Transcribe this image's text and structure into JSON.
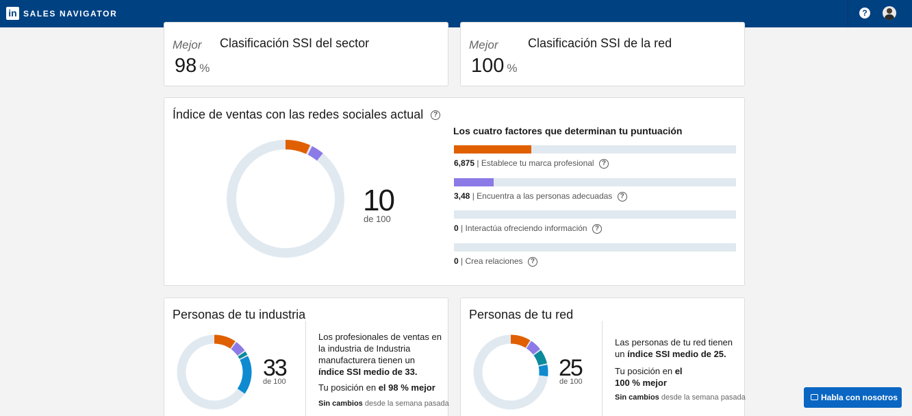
{
  "app": {
    "brand": "SALES NAVIGATOR",
    "logo": "in"
  },
  "industry_rank": {
    "best_label": "Mejor",
    "value": "98",
    "unit": "%",
    "title": "Clasificación SSI del sector"
  },
  "network_rank": {
    "best_label": "Mejor",
    "value": "100",
    "unit": "%",
    "title": "Clasificación SSI de la red"
  },
  "ssi": {
    "title": "Índice de ventas con las redes sociales actual",
    "score": "10",
    "score_sub": "de 100",
    "factors_title": "Los cuatro factores que determinan tu puntuación",
    "factors": [
      {
        "value": "6,875",
        "label": "| Establece tu marca profesional",
        "fraction": 0.275,
        "color": "#e06000"
      },
      {
        "value": "3,48",
        "label": "| Encuentra a las personas adecuadas",
        "fraction": 0.14,
        "color": "#8c7ae6"
      },
      {
        "value": "0",
        "label": "| Interactúa ofreciendo información",
        "fraction": 0,
        "color": "#0a8a9a"
      },
      {
        "value": "0",
        "label": "| Crea relaciones",
        "fraction": 0,
        "color": "#0e8ad0"
      }
    ]
  },
  "industry_people": {
    "title": "Personas de tu industria",
    "score": "33",
    "score_sub": "de 100",
    "desc_1": "Los profesionales de ventas en la industria de Industria manufacturera tienen un",
    "desc_bold": "índice SSI medio de 33.",
    "pos_prefix": "Tu posición en",
    "pos_bold": "el 98 % mejor",
    "change_bold": "Sin cambios",
    "change_rest": "desde la semana pasada"
  },
  "network_people": {
    "title": "Personas de tu red",
    "score": "25",
    "score_sub": "de 100",
    "desc_1": "Las personas de tu red tienen un",
    "desc_bold": "índice SSI medio de 25.",
    "pos_prefix": "Tu posición en",
    "pos_bold_1": "el",
    "pos_bold_2": "100 % mejor",
    "change_bold": "Sin cambios",
    "change_rest": "desde la semana pasada"
  },
  "chat": {
    "label": "Habla con nosotros"
  },
  "colors": {
    "brand": "#004182",
    "track": "#e1e9f0",
    "brand_factor": "#e06000",
    "people_factor": "#8c7ae6",
    "engage_factor": "#0a8a9a",
    "relations_factor": "#0e8ad0",
    "chat_button": "#0a66c2"
  }
}
